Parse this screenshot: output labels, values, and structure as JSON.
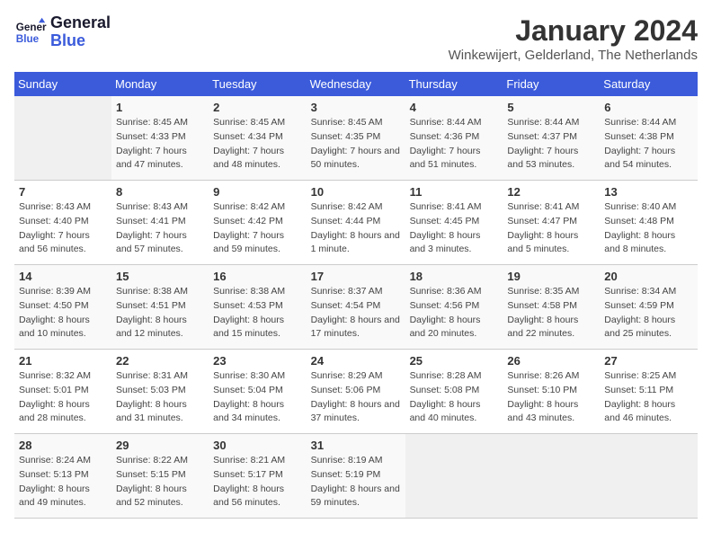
{
  "header": {
    "logo_line1": "General",
    "logo_line2": "Blue",
    "month": "January 2024",
    "location": "Winkewijert, Gelderland, The Netherlands"
  },
  "weekdays": [
    "Sunday",
    "Monday",
    "Tuesday",
    "Wednesday",
    "Thursday",
    "Friday",
    "Saturday"
  ],
  "weeks": [
    [
      {
        "day": "",
        "sunrise": "",
        "sunset": "",
        "daylight": ""
      },
      {
        "day": "1",
        "sunrise": "Sunrise: 8:45 AM",
        "sunset": "Sunset: 4:33 PM",
        "daylight": "Daylight: 7 hours and 47 minutes."
      },
      {
        "day": "2",
        "sunrise": "Sunrise: 8:45 AM",
        "sunset": "Sunset: 4:34 PM",
        "daylight": "Daylight: 7 hours and 48 minutes."
      },
      {
        "day": "3",
        "sunrise": "Sunrise: 8:45 AM",
        "sunset": "Sunset: 4:35 PM",
        "daylight": "Daylight: 7 hours and 50 minutes."
      },
      {
        "day": "4",
        "sunrise": "Sunrise: 8:44 AM",
        "sunset": "Sunset: 4:36 PM",
        "daylight": "Daylight: 7 hours and 51 minutes."
      },
      {
        "day": "5",
        "sunrise": "Sunrise: 8:44 AM",
        "sunset": "Sunset: 4:37 PM",
        "daylight": "Daylight: 7 hours and 53 minutes."
      },
      {
        "day": "6",
        "sunrise": "Sunrise: 8:44 AM",
        "sunset": "Sunset: 4:38 PM",
        "daylight": "Daylight: 7 hours and 54 minutes."
      }
    ],
    [
      {
        "day": "7",
        "sunrise": "Sunrise: 8:43 AM",
        "sunset": "Sunset: 4:40 PM",
        "daylight": "Daylight: 7 hours and 56 minutes."
      },
      {
        "day": "8",
        "sunrise": "Sunrise: 8:43 AM",
        "sunset": "Sunset: 4:41 PM",
        "daylight": "Daylight: 7 hours and 57 minutes."
      },
      {
        "day": "9",
        "sunrise": "Sunrise: 8:42 AM",
        "sunset": "Sunset: 4:42 PM",
        "daylight": "Daylight: 7 hours and 59 minutes."
      },
      {
        "day": "10",
        "sunrise": "Sunrise: 8:42 AM",
        "sunset": "Sunset: 4:44 PM",
        "daylight": "Daylight: 8 hours and 1 minute."
      },
      {
        "day": "11",
        "sunrise": "Sunrise: 8:41 AM",
        "sunset": "Sunset: 4:45 PM",
        "daylight": "Daylight: 8 hours and 3 minutes."
      },
      {
        "day": "12",
        "sunrise": "Sunrise: 8:41 AM",
        "sunset": "Sunset: 4:47 PM",
        "daylight": "Daylight: 8 hours and 5 minutes."
      },
      {
        "day": "13",
        "sunrise": "Sunrise: 8:40 AM",
        "sunset": "Sunset: 4:48 PM",
        "daylight": "Daylight: 8 hours and 8 minutes."
      }
    ],
    [
      {
        "day": "14",
        "sunrise": "Sunrise: 8:39 AM",
        "sunset": "Sunset: 4:50 PM",
        "daylight": "Daylight: 8 hours and 10 minutes."
      },
      {
        "day": "15",
        "sunrise": "Sunrise: 8:38 AM",
        "sunset": "Sunset: 4:51 PM",
        "daylight": "Daylight: 8 hours and 12 minutes."
      },
      {
        "day": "16",
        "sunrise": "Sunrise: 8:38 AM",
        "sunset": "Sunset: 4:53 PM",
        "daylight": "Daylight: 8 hours and 15 minutes."
      },
      {
        "day": "17",
        "sunrise": "Sunrise: 8:37 AM",
        "sunset": "Sunset: 4:54 PM",
        "daylight": "Daylight: 8 hours and 17 minutes."
      },
      {
        "day": "18",
        "sunrise": "Sunrise: 8:36 AM",
        "sunset": "Sunset: 4:56 PM",
        "daylight": "Daylight: 8 hours and 20 minutes."
      },
      {
        "day": "19",
        "sunrise": "Sunrise: 8:35 AM",
        "sunset": "Sunset: 4:58 PM",
        "daylight": "Daylight: 8 hours and 22 minutes."
      },
      {
        "day": "20",
        "sunrise": "Sunrise: 8:34 AM",
        "sunset": "Sunset: 4:59 PM",
        "daylight": "Daylight: 8 hours and 25 minutes."
      }
    ],
    [
      {
        "day": "21",
        "sunrise": "Sunrise: 8:32 AM",
        "sunset": "Sunset: 5:01 PM",
        "daylight": "Daylight: 8 hours and 28 minutes."
      },
      {
        "day": "22",
        "sunrise": "Sunrise: 8:31 AM",
        "sunset": "Sunset: 5:03 PM",
        "daylight": "Daylight: 8 hours and 31 minutes."
      },
      {
        "day": "23",
        "sunrise": "Sunrise: 8:30 AM",
        "sunset": "Sunset: 5:04 PM",
        "daylight": "Daylight: 8 hours and 34 minutes."
      },
      {
        "day": "24",
        "sunrise": "Sunrise: 8:29 AM",
        "sunset": "Sunset: 5:06 PM",
        "daylight": "Daylight: 8 hours and 37 minutes."
      },
      {
        "day": "25",
        "sunrise": "Sunrise: 8:28 AM",
        "sunset": "Sunset: 5:08 PM",
        "daylight": "Daylight: 8 hours and 40 minutes."
      },
      {
        "day": "26",
        "sunrise": "Sunrise: 8:26 AM",
        "sunset": "Sunset: 5:10 PM",
        "daylight": "Daylight: 8 hours and 43 minutes."
      },
      {
        "day": "27",
        "sunrise": "Sunrise: 8:25 AM",
        "sunset": "Sunset: 5:11 PM",
        "daylight": "Daylight: 8 hours and 46 minutes."
      }
    ],
    [
      {
        "day": "28",
        "sunrise": "Sunrise: 8:24 AM",
        "sunset": "Sunset: 5:13 PM",
        "daylight": "Daylight: 8 hours and 49 minutes."
      },
      {
        "day": "29",
        "sunrise": "Sunrise: 8:22 AM",
        "sunset": "Sunset: 5:15 PM",
        "daylight": "Daylight: 8 hours and 52 minutes."
      },
      {
        "day": "30",
        "sunrise": "Sunrise: 8:21 AM",
        "sunset": "Sunset: 5:17 PM",
        "daylight": "Daylight: 8 hours and 56 minutes."
      },
      {
        "day": "31",
        "sunrise": "Sunrise: 8:19 AM",
        "sunset": "Sunset: 5:19 PM",
        "daylight": "Daylight: 8 hours and 59 minutes."
      },
      {
        "day": "",
        "sunrise": "",
        "sunset": "",
        "daylight": ""
      },
      {
        "day": "",
        "sunrise": "",
        "sunset": "",
        "daylight": ""
      },
      {
        "day": "",
        "sunrise": "",
        "sunset": "",
        "daylight": ""
      }
    ]
  ]
}
